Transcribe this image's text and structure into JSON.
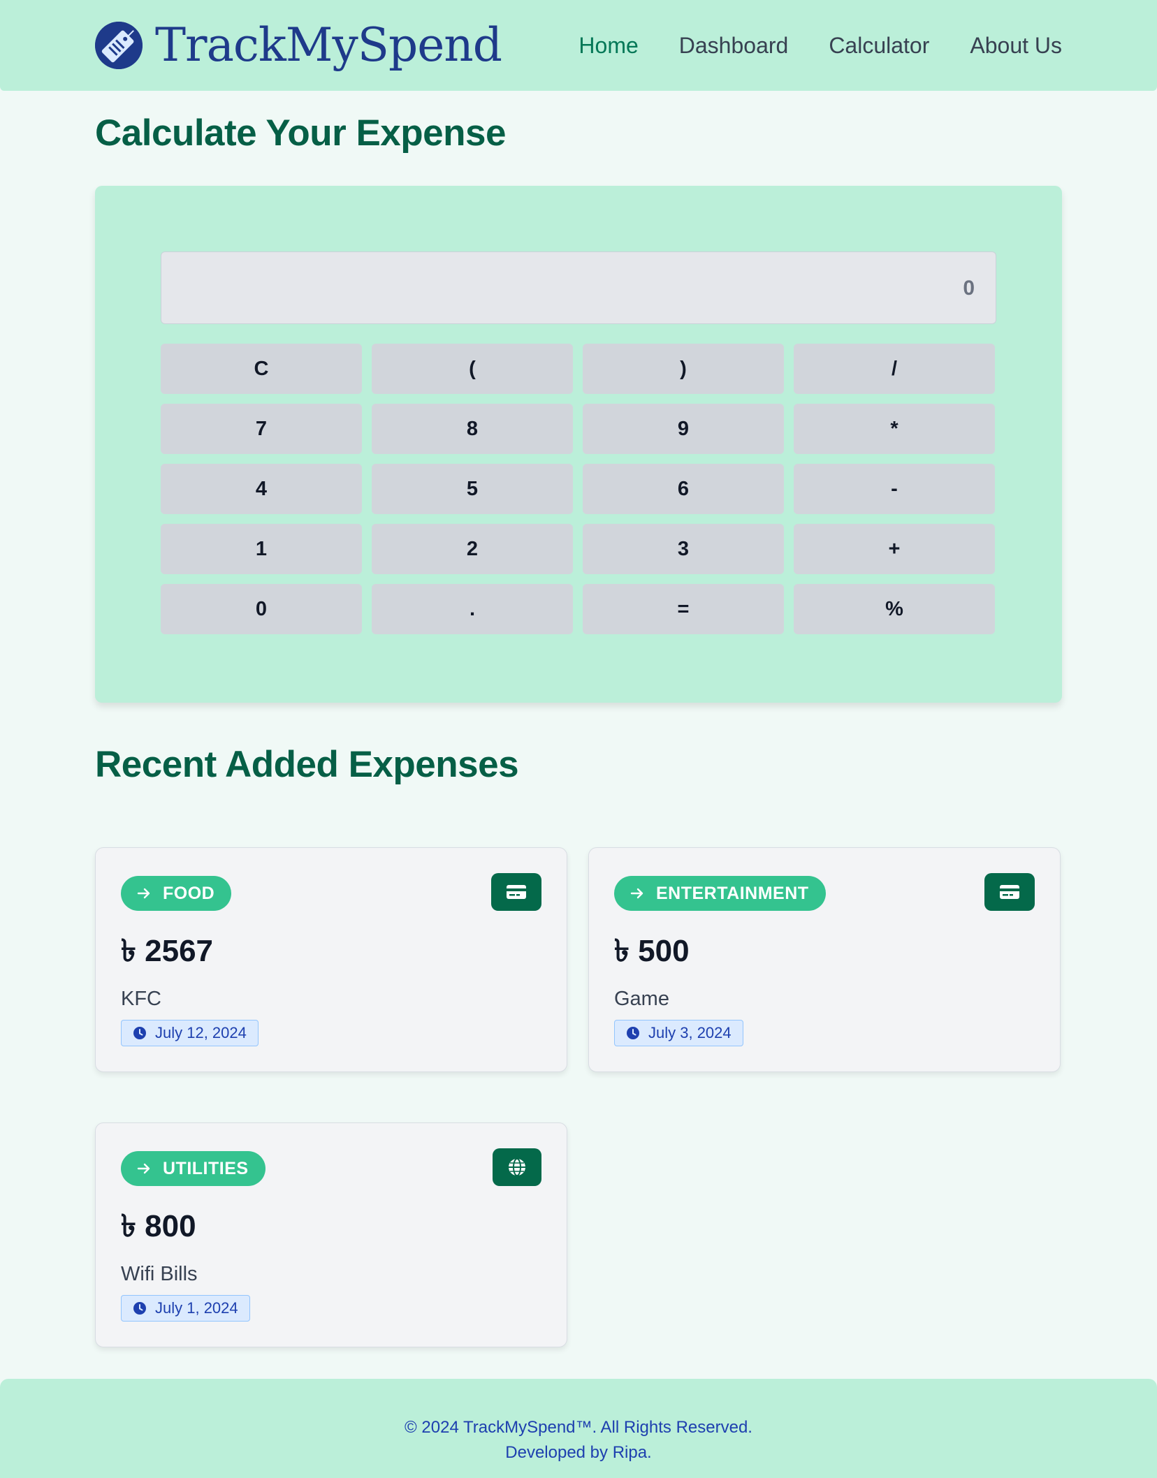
{
  "brand": {
    "name": "TrackMySpend",
    "logo_icon": "price-tag-icon"
  },
  "nav": {
    "items": [
      {
        "label": "Home",
        "active": true
      },
      {
        "label": "Dashboard",
        "active": false
      },
      {
        "label": "Calculator",
        "active": false
      },
      {
        "label": "About Us",
        "active": false
      }
    ]
  },
  "calculator": {
    "title": "Calculate Your Expense",
    "display_value": "0",
    "keys": [
      "C",
      "(",
      ")",
      "/",
      "7",
      "8",
      "9",
      "*",
      "4",
      "5",
      "6",
      "-",
      "1",
      "2",
      "3",
      "+",
      "0",
      ".",
      "=",
      "%"
    ]
  },
  "recent": {
    "title": "Recent Added Expenses",
    "currency_symbol": "৳",
    "expenses": [
      {
        "category": "FOOD",
        "amount": "৳ 2567",
        "description": "KFC",
        "date": "July 12, 2024",
        "icon": "credit-card-icon"
      },
      {
        "category": "ENTERTAINMENT",
        "amount": "৳ 500",
        "description": "Game",
        "date": "July 3, 2024",
        "icon": "credit-card-icon"
      },
      {
        "category": "UTILITIES",
        "amount": "৳ 800",
        "description": "Wifi Bills",
        "date": "July 1, 2024",
        "icon": "globe-icon"
      }
    ]
  },
  "footer": {
    "copyright": "© 2024 TrackMySpend™. All Rights Reserved.",
    "credit": "Developed by Ripa."
  },
  "colors": {
    "header_bg": "#bbefd9",
    "page_bg": "#f0f9f6",
    "heading": "#065f46",
    "brand": "#1e3a8a",
    "badge": "#34c38f",
    "icon_button": "#04694a",
    "key": "#d1d5db"
  }
}
